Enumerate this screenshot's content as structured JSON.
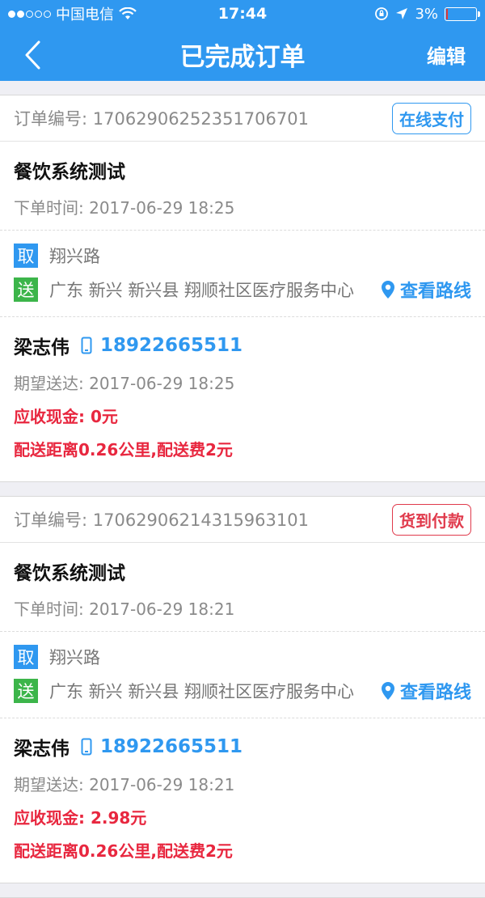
{
  "status_bar": {
    "carrier": "中国电信",
    "time": "17:44",
    "battery": "3%",
    "battery_level": 0.03
  },
  "nav": {
    "title": "已完成订单",
    "edit_label": "编辑"
  },
  "colors": {
    "primary": "#2f98f0",
    "pickup_tag": "#2f98f0",
    "deliver_tag": "#3cb54a",
    "alert_red": "#e8273f"
  },
  "orders": [
    {
      "order_no": "订单编号: 17062906252351706701",
      "payment": "在线支付",
      "shop_name": "餐饮系统测试",
      "order_time": "下单时间: 2017-06-29 18:25",
      "pickup_tag": "取",
      "pickup_addr": "翔兴路",
      "deliver_tag": "送",
      "deliver_addr": "广东 新兴 新兴县 翔顺社区医疗服务中心",
      "route_label": "查看路线",
      "customer_name": "梁志伟",
      "phone": "18922665511",
      "expect_time": "期望送达: 2017-06-29 18:25",
      "cash": "应收现金: 0元",
      "distance": "配送距离0.26公里,配送费2元"
    },
    {
      "order_no": "订单编号: 17062906214315963101",
      "payment": "货到付款",
      "shop_name": "餐饮系统测试",
      "order_time": "下单时间: 2017-06-29 18:21",
      "pickup_tag": "取",
      "pickup_addr": "翔兴路",
      "deliver_tag": "送",
      "deliver_addr": "广东 新兴 新兴县 翔顺社区医疗服务中心",
      "route_label": "查看路线",
      "customer_name": "梁志伟",
      "phone": "18922665511",
      "expect_time": "期望送达: 2017-06-29 18:21",
      "cash": "应收现金: 2.98元",
      "distance": "配送距离0.26公里,配送费2元"
    }
  ]
}
